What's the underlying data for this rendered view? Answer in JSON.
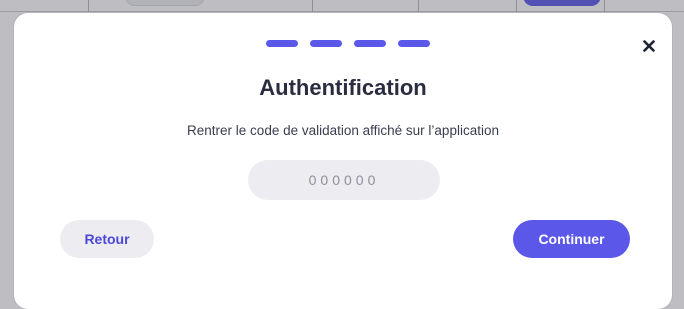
{
  "background": {
    "accent_color": "#5b57e8"
  },
  "modal": {
    "step_count": 4,
    "steps_color": "#5b57e8",
    "close_icon": "close-icon",
    "title": "Authentification",
    "subtitle": "Rentrer le code de validation affiché sur l’application",
    "code_input": {
      "placeholder": "000000",
      "value": ""
    },
    "back_label": "Retour",
    "continue_label": "Continuer"
  }
}
